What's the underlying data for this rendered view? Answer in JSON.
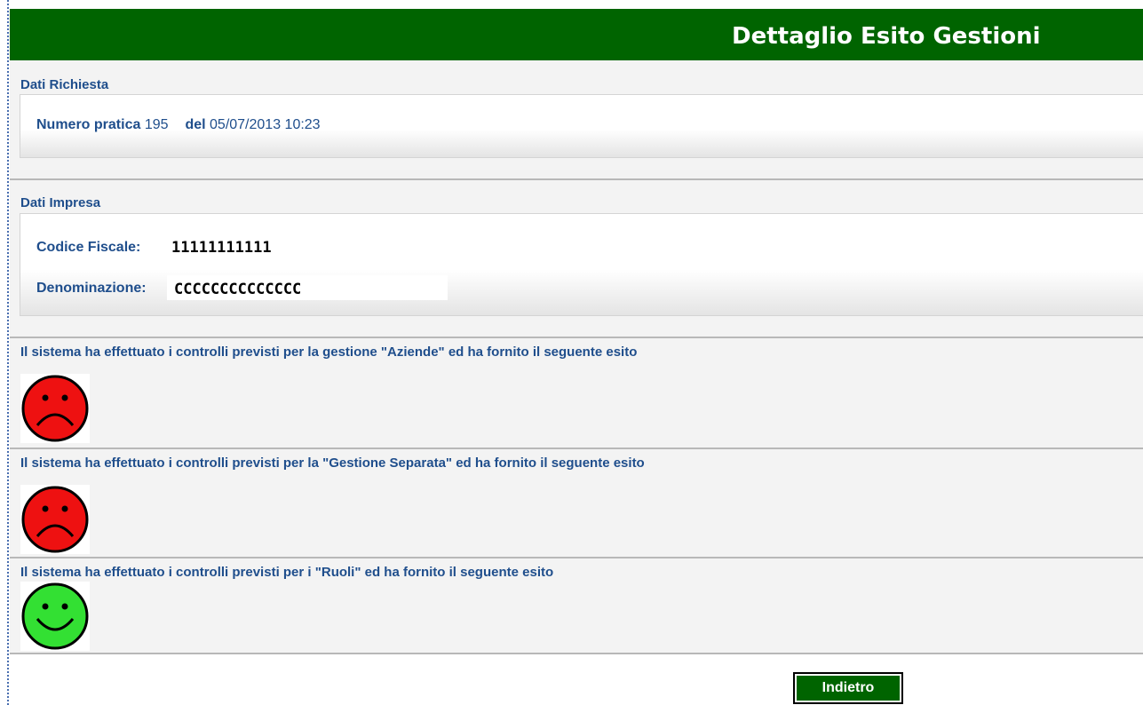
{
  "header": {
    "title": "Dettaglio Esito Gestioni"
  },
  "dati_richiesta": {
    "section_title": "Dati Richiesta",
    "numero_pratica_label": "Numero pratica",
    "numero_pratica_value": "195",
    "del_label": "del",
    "del_value": "05/07/2013 10:23"
  },
  "dati_impresa": {
    "section_title": "Dati Impresa",
    "codice_fiscale_label": "Codice Fiscale:",
    "codice_fiscale_value": "11111111111",
    "denominazione_label": "Denominazione:",
    "denominazione_value": "CCCCCCCCCCCCCC"
  },
  "esiti": [
    {
      "message": "Il sistema ha effettuato i controlli previsti per la gestione \"Aziende\" ed ha fornito il seguente esito",
      "outcome": "negative",
      "icon": "sad-face-icon",
      "color": "#ee1111"
    },
    {
      "message": "Il sistema ha effettuato i controlli previsti per la \"Gestione Separata\" ed ha fornito il seguente esito",
      "outcome": "negative",
      "icon": "sad-face-icon",
      "color": "#ee1111"
    },
    {
      "message": "Il sistema ha effettuato i controlli previsti per i \"Ruoli\" ed ha fornito il seguente esito",
      "outcome": "positive",
      "icon": "happy-face-icon",
      "color": "#33e033"
    }
  ],
  "actions": {
    "back_label": "Indietro"
  },
  "colors": {
    "header_bg": "#006400",
    "label_text": "#1f4e8c",
    "section_bg": "#f3f3f3"
  }
}
